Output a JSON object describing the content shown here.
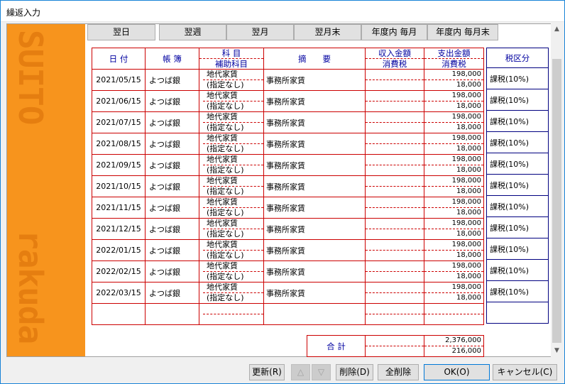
{
  "window": {
    "title": "繰返入力"
  },
  "sidebar": {
    "watermark_top": "SUITO",
    "watermark_bottom": "rakuda"
  },
  "repeat_buttons": [
    "翌日",
    "翌週",
    "翌月",
    "翌月末",
    "年度内 毎月",
    "年度内 毎月末"
  ],
  "header": {
    "date": "日 付",
    "book": "帳 簿",
    "subject": "科 目",
    "sub_subject": "補助科目",
    "description": "摘　　要",
    "income": "収入金額",
    "income_tax": "消費税",
    "expense": "支出金額",
    "expense_tax": "消費税",
    "tax_class": "税区分"
  },
  "rows": [
    {
      "date": "2021/05/15",
      "book": "よつば銀",
      "subject": "地代家賃",
      "sub_subject": "(指定なし)",
      "description": "事務所家賃",
      "income": "",
      "income_tax": "",
      "expense": "198,000",
      "expense_tax": "18,000",
      "tax_class": "課税(10%)"
    },
    {
      "date": "2021/06/15",
      "book": "よつば銀",
      "subject": "地代家賃",
      "sub_subject": "(指定なし)",
      "description": "事務所家賃",
      "income": "",
      "income_tax": "",
      "expense": "198,000",
      "expense_tax": "18,000",
      "tax_class": "課税(10%)"
    },
    {
      "date": "2021/07/15",
      "book": "よつば銀",
      "subject": "地代家賃",
      "sub_subject": "(指定なし)",
      "description": "事務所家賃",
      "income": "",
      "income_tax": "",
      "expense": "198,000",
      "expense_tax": "18,000",
      "tax_class": "課税(10%)"
    },
    {
      "date": "2021/08/15",
      "book": "よつば銀",
      "subject": "地代家賃",
      "sub_subject": "(指定なし)",
      "description": "事務所家賃",
      "income": "",
      "income_tax": "",
      "expense": "198,000",
      "expense_tax": "18,000",
      "tax_class": "課税(10%)"
    },
    {
      "date": "2021/09/15",
      "book": "よつば銀",
      "subject": "地代家賃",
      "sub_subject": "(指定なし)",
      "description": "事務所家賃",
      "income": "",
      "income_tax": "",
      "expense": "198,000",
      "expense_tax": "18,000",
      "tax_class": "課税(10%)"
    },
    {
      "date": "2021/10/15",
      "book": "よつば銀",
      "subject": "地代家賃",
      "sub_subject": "(指定なし)",
      "description": "事務所家賃",
      "income": "",
      "income_tax": "",
      "expense": "198,000",
      "expense_tax": "18,000",
      "tax_class": "課税(10%)"
    },
    {
      "date": "2021/11/15",
      "book": "よつば銀",
      "subject": "地代家賃",
      "sub_subject": "(指定なし)",
      "description": "事務所家賃",
      "income": "",
      "income_tax": "",
      "expense": "198,000",
      "expense_tax": "18,000",
      "tax_class": "課税(10%)"
    },
    {
      "date": "2021/12/15",
      "book": "よつば銀",
      "subject": "地代家賃",
      "sub_subject": "(指定なし)",
      "description": "事務所家賃",
      "income": "",
      "income_tax": "",
      "expense": "198,000",
      "expense_tax": "18,000",
      "tax_class": "課税(10%)"
    },
    {
      "date": "2022/01/15",
      "book": "よつば銀",
      "subject": "地代家賃",
      "sub_subject": "(指定なし)",
      "description": "事務所家賃",
      "income": "",
      "income_tax": "",
      "expense": "198,000",
      "expense_tax": "18,000",
      "tax_class": "課税(10%)"
    },
    {
      "date": "2022/02/15",
      "book": "よつば銀",
      "subject": "地代家賃",
      "sub_subject": "(指定なし)",
      "description": "事務所家賃",
      "income": "",
      "income_tax": "",
      "expense": "198,000",
      "expense_tax": "18,000",
      "tax_class": "課税(10%)"
    },
    {
      "date": "2022/03/15",
      "book": "よつば銀",
      "subject": "地代家賃",
      "sub_subject": "(指定なし)",
      "description": "事務所家賃",
      "income": "",
      "income_tax": "",
      "expense": "198,000",
      "expense_tax": "18,000",
      "tax_class": "課税(10%)"
    },
    {
      "date": "",
      "book": "",
      "subject": "",
      "sub_subject": "",
      "description": "",
      "income": "",
      "income_tax": "",
      "expense": "",
      "expense_tax": "",
      "tax_class": ""
    }
  ],
  "totals": {
    "label": "合 計",
    "income": "",
    "income_tax": "",
    "expense": "2,376,000",
    "expense_tax": "216,000"
  },
  "footer": {
    "update": "更新(R)",
    "up": "△",
    "down": "▽",
    "delete": "削除(D)",
    "delete_all": "全削除",
    "ok": "OK(O)",
    "cancel": "キャンセル(C)"
  },
  "icons": {
    "scroll_up": "scroll-up-arrow-icon",
    "scroll_down": "scroll-down-arrow-icon"
  }
}
